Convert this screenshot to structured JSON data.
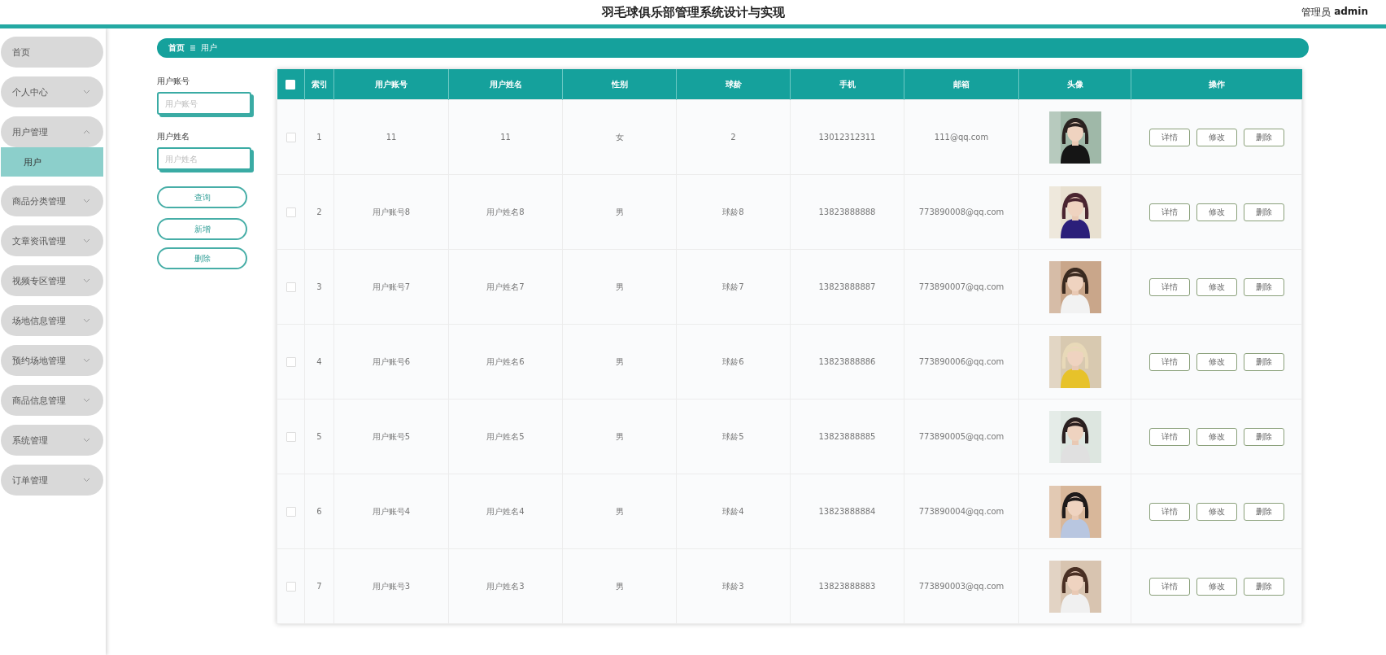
{
  "header": {
    "title": "羽毛球俱乐部管理系统设计与实现",
    "role": "管理员",
    "user": "admin"
  },
  "sidebar": {
    "items": [
      {
        "label": "首页",
        "kind": "link",
        "selected": false
      },
      {
        "label": "个人中心",
        "kind": "menu",
        "expanded": false,
        "selected": false
      },
      {
        "label": "用户管理",
        "kind": "menu",
        "expanded": true,
        "selected": false,
        "children": [
          {
            "label": "用户",
            "selected": true
          }
        ]
      },
      {
        "label": "商品分类管理",
        "kind": "menu",
        "expanded": false,
        "selected": false
      },
      {
        "label": "文章资讯管理",
        "kind": "menu",
        "expanded": false,
        "selected": false
      },
      {
        "label": "视频专区管理",
        "kind": "menu",
        "expanded": false,
        "selected": false
      },
      {
        "label": "场地信息管理",
        "kind": "menu",
        "expanded": false,
        "selected": false
      },
      {
        "label": "预约场地管理",
        "kind": "menu",
        "expanded": false,
        "selected": false
      },
      {
        "label": "商品信息管理",
        "kind": "menu",
        "expanded": false,
        "selected": false
      },
      {
        "label": "系统管理",
        "kind": "menu",
        "expanded": false,
        "selected": false
      },
      {
        "label": "订单管理",
        "kind": "menu",
        "expanded": false,
        "selected": false
      }
    ]
  },
  "breadcrumb": [
    "首页",
    "用户"
  ],
  "search": {
    "fields": [
      {
        "label": "用户账号",
        "placeholder": "用户账号"
      },
      {
        "label": "用户姓名",
        "placeholder": "用户姓名"
      }
    ],
    "buttons": [
      "查询",
      "新增",
      "删除"
    ]
  },
  "table": {
    "select_all": {
      "checked": false
    },
    "columns": [
      "索引",
      "用户账号",
      "用户姓名",
      "性别",
      "球龄",
      "手机",
      "邮箱",
      "头像",
      "操作"
    ],
    "rows": [
      {
        "checked": false,
        "cells": [
          "1",
          "11",
          "11",
          "女",
          "2",
          "13012312311",
          "111@qq.com"
        ],
        "actions": [
          "详情",
          "修改",
          "删除"
        ]
      },
      {
        "checked": false,
        "cells": [
          "2",
          "用户账号8",
          "用户姓名8",
          "男",
          "球龄8",
          "13823888888",
          "773890008@qq.com"
        ],
        "actions": [
          "详情",
          "修改",
          "删除"
        ]
      },
      {
        "checked": false,
        "cells": [
          "3",
          "用户账号7",
          "用户姓名7",
          "男",
          "球龄7",
          "13823888887",
          "773890007@qq.com"
        ],
        "actions": [
          "详情",
          "修改",
          "删除"
        ]
      },
      {
        "checked": false,
        "cells": [
          "4",
          "用户账号6",
          "用户姓名6",
          "男",
          "球龄6",
          "13823888886",
          "773890006@qq.com"
        ],
        "actions": [
          "详情",
          "修改",
          "删除"
        ]
      },
      {
        "checked": false,
        "cells": [
          "5",
          "用户账号5",
          "用户姓名5",
          "男",
          "球龄5",
          "13823888885",
          "773890005@qq.com"
        ],
        "actions": [
          "详情",
          "修改",
          "删除"
        ]
      },
      {
        "checked": false,
        "cells": [
          "6",
          "用户账号4",
          "用户姓名4",
          "男",
          "球龄4",
          "13823888884",
          "773890004@qq.com"
        ],
        "actions": [
          "详情",
          "修改",
          "删除"
        ]
      },
      {
        "checked": false,
        "cells": [
          "7",
          "用户账号3",
          "用户姓名3",
          "男",
          "球龄3",
          "13823888883",
          "773890003@qq.com"
        ],
        "actions": [
          "详情",
          "修改",
          "删除"
        ]
      }
    ]
  }
}
